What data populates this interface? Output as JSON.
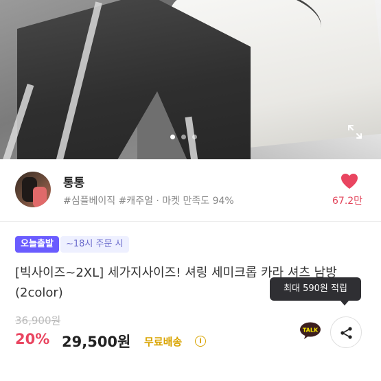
{
  "gallery": {
    "slide_count": 3,
    "active_slide": 1,
    "expand_icon": "expand-icon"
  },
  "seller": {
    "name": "통통",
    "tags": "#심플베이직 #캐주얼 · 마켓 만족도 94%",
    "likes": "67.2만",
    "heart_color": "#e94560"
  },
  "product": {
    "badge_today": "오늘출발",
    "badge_order": "~18시 주문 시",
    "title": "[빅사이즈~2XL] 세가지사이즈! 셔링 세미크롭 카라 셔츠 남방(2color)",
    "original_price": "36,900원",
    "discount": "20%",
    "price": "29,500원",
    "shipping": "무료배송",
    "tooltip": "최대 590원 적립"
  },
  "actions": {
    "talk_label": "TALK",
    "share_icon": "share-icon"
  },
  "colors": {
    "accent_purple": "#6a5cff",
    "discount_red": "#e94560",
    "shipping_yellow": "#d9a400"
  }
}
